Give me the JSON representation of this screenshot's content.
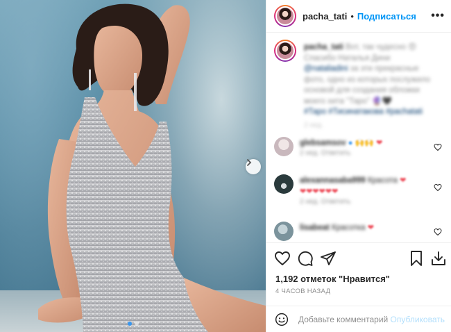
{
  "post": {
    "image_alt": "Фото pacha_tati",
    "carousel": {
      "total": 2,
      "active": 1
    }
  },
  "header": {
    "username": "pacha_tati",
    "separator": "•",
    "follow_label": "Подписаться",
    "more_icon": "more-horizontal-icon"
  },
  "caption": {
    "username": "pacha_tati",
    "lines": [
      "Вот, так чудесно",
      "Спасибо Наталья Дини",
      "за эти прекрасные",
      "фото, одно из которых послужило",
      "основой для создания обложки",
      "моего хита \"Таро\""
    ],
    "tags": "#Таро #Тисинатакова #pachatati",
    "meta": "2 нед."
  },
  "comments": [
    {
      "username": "glebsamsov",
      "text": "",
      "meta": "2 нед.  Ответить",
      "avatar_color": "#d9d0d4"
    },
    {
      "username": "alexannasaba999",
      "text": "Красота",
      "meta": "2 нед.  Ответить",
      "avatar_color": "#2c3f3f"
    },
    {
      "username": "lisabeat",
      "text": "Красотка",
      "meta": "",
      "avatar_color": "#8aa3ad"
    }
  ],
  "actions": {
    "like_icon": "heart-icon",
    "comment_icon": "comment-icon",
    "share_icon": "share-icon",
    "save_icon": "bookmark-icon",
    "download_icon": "download-icon"
  },
  "likes_text": "1,192 отметок \"Нравится\"",
  "time_text": "4 ЧАСОВ НАЗАД",
  "add_comment": {
    "placeholder": "Добавьте комментарий...",
    "publish_label": "Опубликовать"
  },
  "colors": {
    "accent": "#0095f6",
    "carousel_dot_active": "#3897f0",
    "heart_red": "#ed4956"
  }
}
